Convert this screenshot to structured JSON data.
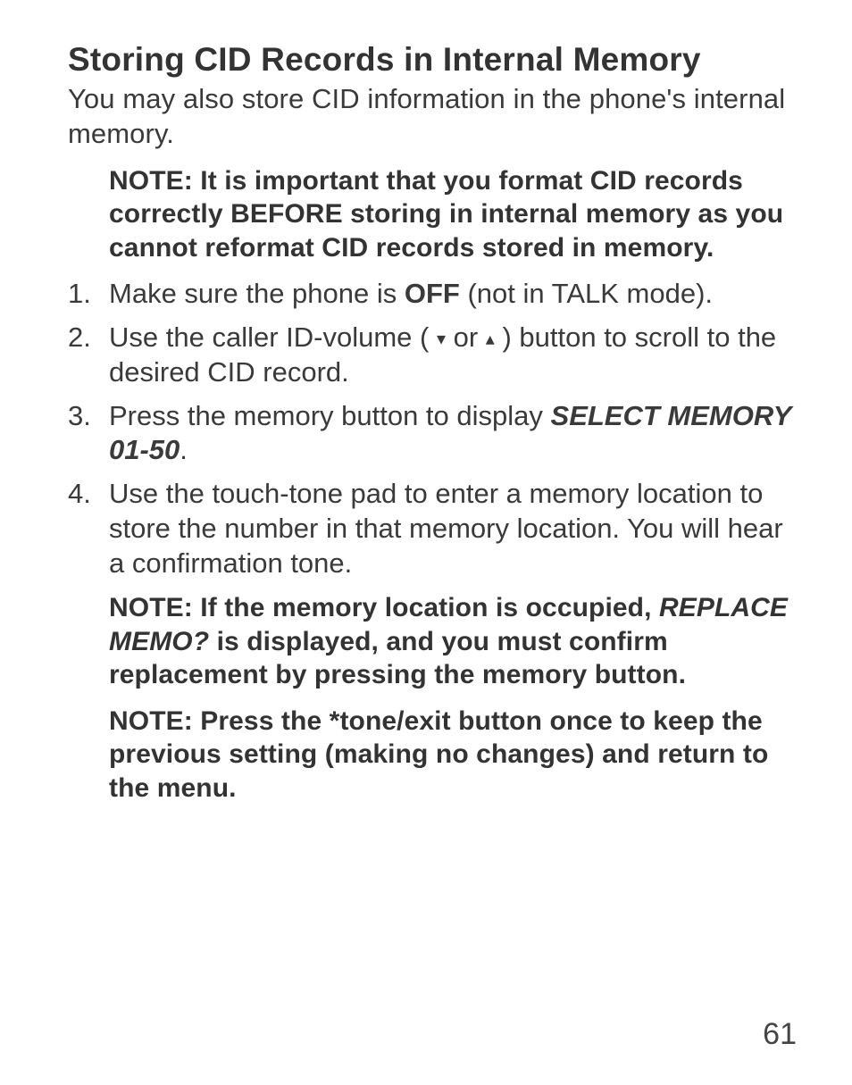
{
  "heading": "Storing CID Records in Internal Memory",
  "intro": "You may also store CID information in the phone's internal memory.",
  "note1": "NOTE: It is important that you format CID records correctly BEFORE storing in internal memory as you cannot reformat CID records stored in memory.",
  "list": {
    "item1": {
      "num": "1.",
      "pre": "Make sure the phone is ",
      "bold": "OFF",
      "post": " (not in TALK mode)."
    },
    "item2": {
      "num": "2.",
      "pre": "Use the caller ID-volume ( ",
      "down": "▾",
      "mid": " or ",
      "up": "▴",
      "post": " ) button to scroll to the desired CID record."
    },
    "item3": {
      "num": "3.",
      "pre": "Press the memory button to display ",
      "bold": "SELECT MEMORY 01-50",
      "post": "."
    },
    "item4": {
      "num": "4.",
      "text": "Use the touch-tone pad to enter a memory location to store the number in that memory location. You will hear a confirmation tone."
    }
  },
  "note2": {
    "pre": "NOTE: If the memory location is occupied, ",
    "bold": "REPLACE MEMO?",
    "post": " is displayed, and you must confirm replacement by pressing the memory button."
  },
  "note3": "NOTE: Press the *tone/exit button once to keep the previous setting (making no changes) and return to the menu.",
  "pagenum": "61"
}
